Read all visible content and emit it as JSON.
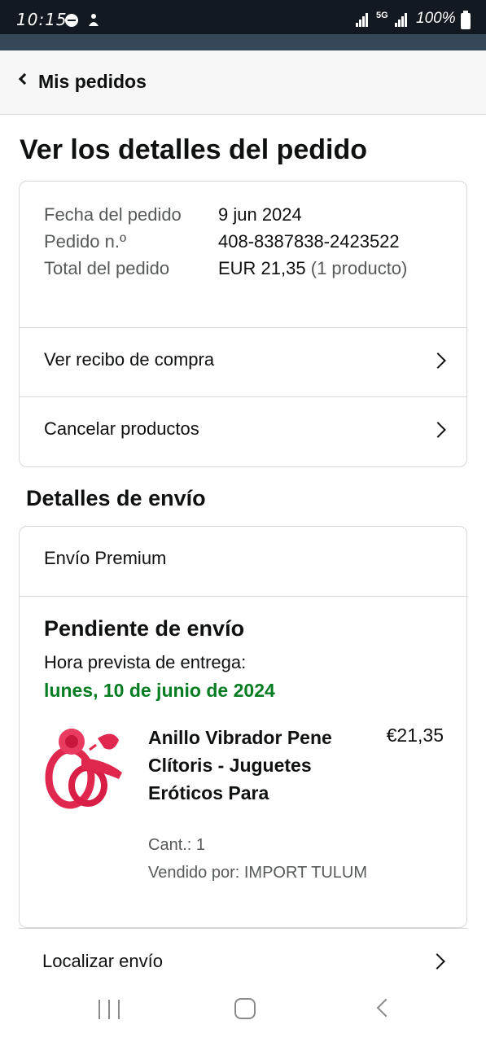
{
  "status_bar": {
    "time": "10:15",
    "network": "5G",
    "battery": "100%"
  },
  "nav": {
    "back_label": "Mis pedidos",
    "back_icon": "chevron-left-icon"
  },
  "page": {
    "title": "Ver los detalles del pedido"
  },
  "order_summary": {
    "rows": [
      {
        "label": "Fecha del pedido",
        "value": "9 jun 2024",
        "extra": ""
      },
      {
        "label": "Pedido n.º",
        "value": "408-8387838-2423522",
        "extra": ""
      },
      {
        "label": "Total del pedido",
        "value": "EUR 21,35",
        "extra": "(1 producto)"
      }
    ],
    "actions": [
      {
        "label": "Ver recibo de compra",
        "icon": "chevron-right-icon"
      },
      {
        "label": "Cancelar productos",
        "icon": "chevron-right-icon"
      }
    ]
  },
  "shipping": {
    "section_title": "Detalles de envío",
    "type": "Envío Premium",
    "status": "Pendiente de envío",
    "eta_label": "Hora prevista de entrega:",
    "eta_date": "lunes, 10 de junio de 2024",
    "eta_color": "#067d22",
    "product": {
      "name": "Anillo Vibrador Pene Clítoris - Juguetes Eróticos Para",
      "price": "€21,35",
      "qty": "Cant.: 1",
      "seller": "Vendido por: IMPORT TULUM",
      "image_color": "#e0284f"
    },
    "track_label": "Localizar envío"
  },
  "system_nav": {
    "recent_icon": "recent-apps-icon",
    "home_icon": "home-icon",
    "back_icon": "back-icon"
  }
}
